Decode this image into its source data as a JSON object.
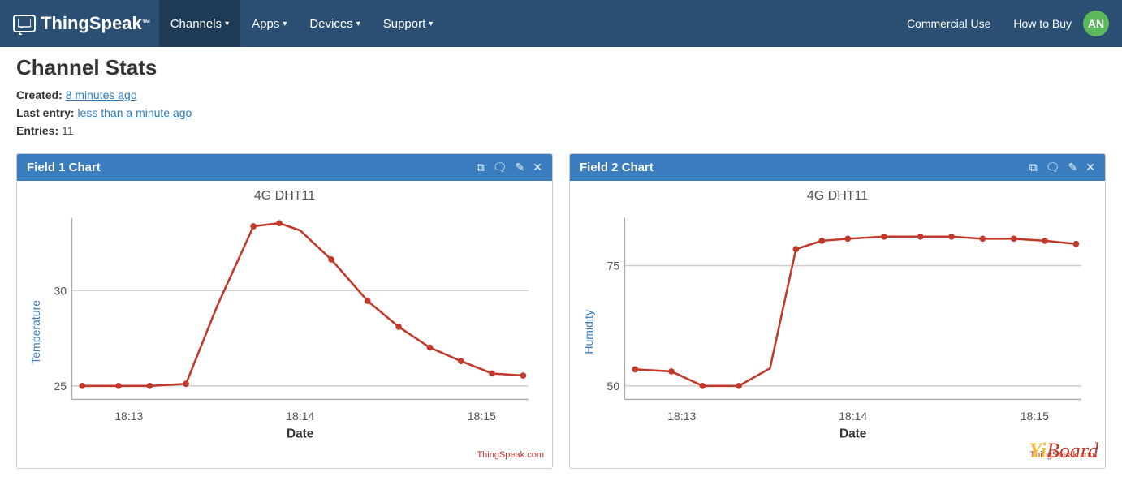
{
  "navbar": {
    "brand": "ThingSpeak",
    "tm": "™",
    "channels_label": "Channels",
    "apps_label": "Apps",
    "devices_label": "Devices",
    "support_label": "Support",
    "commercial_label": "Commercial Use",
    "how_to_buy_label": "How to Buy",
    "user_initials": "AN"
  },
  "page": {
    "channel_title": "Channel Stats",
    "created_label": "Created:",
    "created_value": "8 minutes ago",
    "last_entry_label": "Last entry:",
    "last_entry_value": "less than a minute ago",
    "entries_label": "Entries:",
    "entries_value": "11"
  },
  "chart1": {
    "header_title": "Field 1 Chart",
    "chart_title": "4G DHT11",
    "y_axis_label": "Temperature",
    "x_axis_label": "Date",
    "attribution": "ThingSpeak.com",
    "y_min": 25,
    "y_max": 35,
    "y_ticks": [
      25,
      30
    ],
    "x_ticks": [
      "18:13",
      "18:14",
      "18:15"
    ]
  },
  "chart2": {
    "header_title": "Field 2 Chart",
    "chart_title": "4G DHT11",
    "y_axis_label": "Humidity",
    "x_axis_label": "Date",
    "attribution": "ThingSpeak.com",
    "y_min": 50,
    "y_max": 85,
    "y_ticks": [
      50,
      75
    ],
    "x_ticks": [
      "18:13",
      "18:14",
      "18:15"
    ]
  },
  "icons": {
    "external_link": "⧉",
    "comment": "💬",
    "edit": "✎",
    "close": "✕"
  }
}
